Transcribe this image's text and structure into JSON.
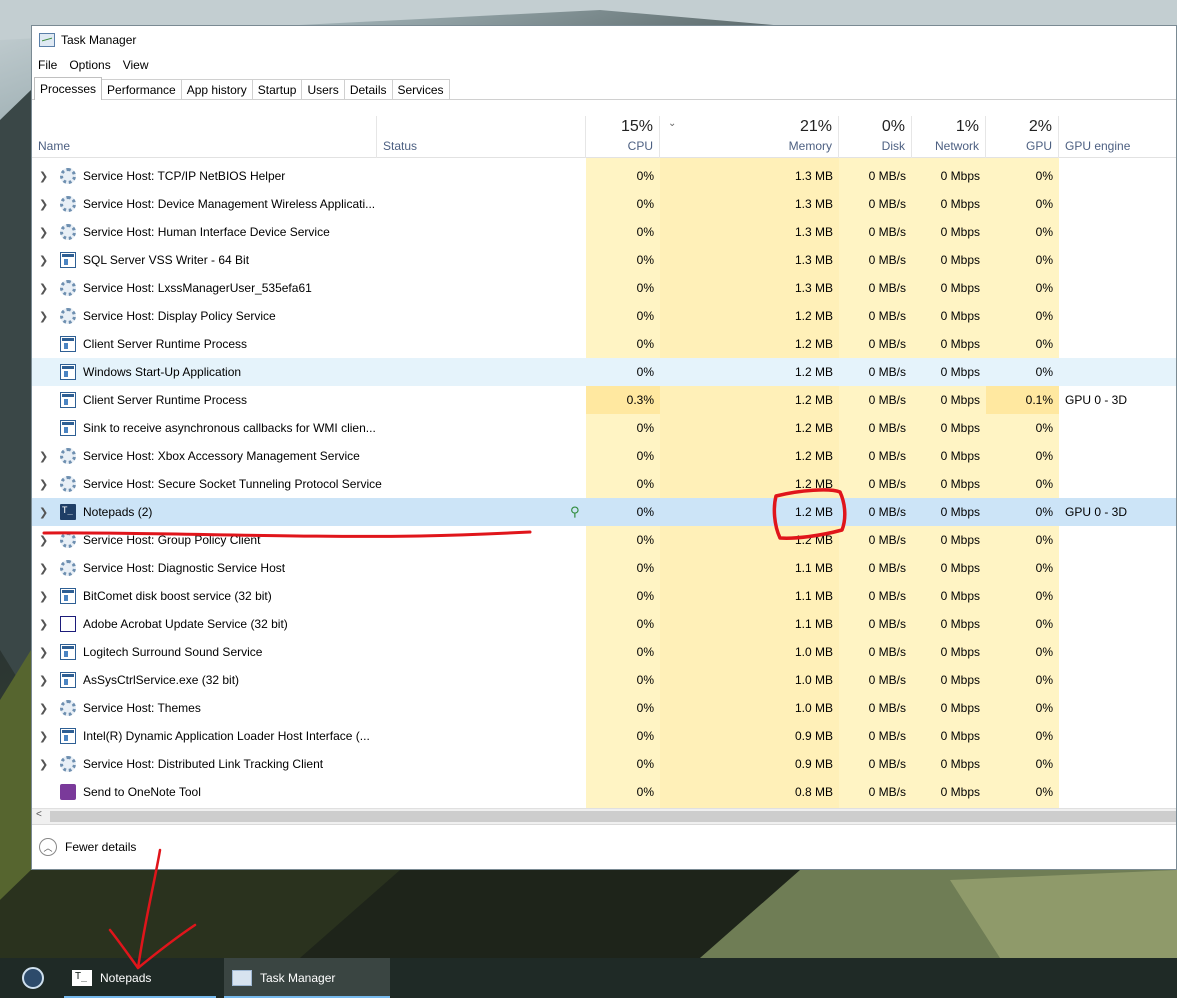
{
  "window": {
    "title": "Task Manager"
  },
  "menu": [
    "File",
    "Options",
    "View"
  ],
  "tabs": [
    "Processes",
    "Performance",
    "App history",
    "Startup",
    "Users",
    "Details",
    "Services"
  ],
  "columns": {
    "name": "Name",
    "status": "Status",
    "cpu": {
      "pct": "15%",
      "label": "CPU"
    },
    "memory": {
      "pct": "21%",
      "label": "Memory"
    },
    "disk": {
      "pct": "0%",
      "label": "Disk"
    },
    "network": {
      "pct": "1%",
      "label": "Network"
    },
    "gpu": {
      "pct": "2%",
      "label": "GPU"
    },
    "gpu_engine": "GPU engine"
  },
  "colors": {
    "cpu_heat": "#fff4c4",
    "mem_heat": "#fff0b8",
    "selected": "#cce4f7",
    "hover": "#e5f3fb",
    "annotation": "#e0151b"
  },
  "processes": [
    {
      "name": "Service Host: TCP/IP NetBIOS Helper",
      "icon": "gear-icon",
      "expand": true,
      "cpu": "0%",
      "memory": "1.3 MB",
      "disk": "0 MB/s",
      "network": "0 Mbps",
      "gpu": "0%",
      "engine": ""
    },
    {
      "name": "Service Host: Device Management Wireless Applicati...",
      "icon": "gear-icon",
      "expand": true,
      "cpu": "0%",
      "memory": "1.3 MB",
      "disk": "0 MB/s",
      "network": "0 Mbps",
      "gpu": "0%",
      "engine": ""
    },
    {
      "name": "Service Host: Human Interface Device Service",
      "icon": "gear-icon",
      "expand": true,
      "cpu": "0%",
      "memory": "1.3 MB",
      "disk": "0 MB/s",
      "network": "0 Mbps",
      "gpu": "0%",
      "engine": ""
    },
    {
      "name": "SQL Server VSS Writer - 64 Bit",
      "icon": "app-icon",
      "expand": true,
      "cpu": "0%",
      "memory": "1.3 MB",
      "disk": "0 MB/s",
      "network": "0 Mbps",
      "gpu": "0%",
      "engine": ""
    },
    {
      "name": "Service Host: LxssManagerUser_535efa61",
      "icon": "gear-icon",
      "expand": true,
      "cpu": "0%",
      "memory": "1.3 MB",
      "disk": "0 MB/s",
      "network": "0 Mbps",
      "gpu": "0%",
      "engine": ""
    },
    {
      "name": "Service Host: Display Policy Service",
      "icon": "gear-icon",
      "expand": true,
      "cpu": "0%",
      "memory": "1.2 MB",
      "disk": "0 MB/s",
      "network": "0 Mbps",
      "gpu": "0%",
      "engine": ""
    },
    {
      "name": "Client Server Runtime Process",
      "icon": "app-icon",
      "expand": false,
      "cpu": "0%",
      "memory": "1.2 MB",
      "disk": "0 MB/s",
      "network": "0 Mbps",
      "gpu": "0%",
      "engine": ""
    },
    {
      "name": "Windows Start-Up Application",
      "icon": "app-icon",
      "expand": false,
      "cpu": "0%",
      "memory": "1.2 MB",
      "disk": "0 MB/s",
      "network": "0 Mbps",
      "gpu": "0%",
      "engine": "",
      "state": "hover"
    },
    {
      "name": "Client Server Runtime Process",
      "icon": "app-icon",
      "expand": false,
      "cpu": "0.3%",
      "memory": "1.2 MB",
      "disk": "0 MB/s",
      "network": "0 Mbps",
      "gpu": "0.1%",
      "engine": "GPU 0 - 3D",
      "hot": true
    },
    {
      "name": "Sink to receive asynchronous callbacks for WMI clien...",
      "icon": "app-icon",
      "expand": false,
      "cpu": "0%",
      "memory": "1.2 MB",
      "disk": "0 MB/s",
      "network": "0 Mbps",
      "gpu": "0%",
      "engine": ""
    },
    {
      "name": "Service Host: Xbox Accessory Management Service",
      "icon": "gear-icon",
      "expand": true,
      "cpu": "0%",
      "memory": "1.2 MB",
      "disk": "0 MB/s",
      "network": "0 Mbps",
      "gpu": "0%",
      "engine": ""
    },
    {
      "name": "Service Host: Secure Socket Tunneling Protocol Service",
      "icon": "gear-icon",
      "expand": true,
      "cpu": "0%",
      "memory": "1.2 MB",
      "disk": "0 MB/s",
      "network": "0 Mbps",
      "gpu": "0%",
      "engine": ""
    },
    {
      "name": "Notepads (2)",
      "icon": "notepads-icon",
      "expand": true,
      "cpu": "0%",
      "memory": "1.2 MB",
      "disk": "0 MB/s",
      "network": "0 Mbps",
      "gpu": "0%",
      "engine": "GPU 0 - 3D",
      "state": "selected",
      "leaf": true
    },
    {
      "name": "Service Host: Group Policy Client",
      "icon": "gear-icon",
      "expand": true,
      "cpu": "0%",
      "memory": "1.2 MB",
      "disk": "0 MB/s",
      "network": "0 Mbps",
      "gpu": "0%",
      "engine": ""
    },
    {
      "name": "Service Host: Diagnostic Service Host",
      "icon": "gear-icon",
      "expand": true,
      "cpu": "0%",
      "memory": "1.1 MB",
      "disk": "0 MB/s",
      "network": "0 Mbps",
      "gpu": "0%",
      "engine": ""
    },
    {
      "name": "BitComet disk boost service (32 bit)",
      "icon": "app-icon",
      "expand": true,
      "cpu": "0%",
      "memory": "1.1 MB",
      "disk": "0 MB/s",
      "network": "0 Mbps",
      "gpu": "0%",
      "engine": ""
    },
    {
      "name": "Adobe Acrobat Update Service (32 bit)",
      "icon": "window-icon",
      "expand": true,
      "cpu": "0%",
      "memory": "1.1 MB",
      "disk": "0 MB/s",
      "network": "0 Mbps",
      "gpu": "0%",
      "engine": ""
    },
    {
      "name": "Logitech Surround Sound Service",
      "icon": "app-icon",
      "expand": true,
      "cpu": "0%",
      "memory": "1.0 MB",
      "disk": "0 MB/s",
      "network": "0 Mbps",
      "gpu": "0%",
      "engine": ""
    },
    {
      "name": "AsSysCtrlService.exe (32 bit)",
      "icon": "app-icon",
      "expand": true,
      "cpu": "0%",
      "memory": "1.0 MB",
      "disk": "0 MB/s",
      "network": "0 Mbps",
      "gpu": "0%",
      "engine": ""
    },
    {
      "name": "Service Host: Themes",
      "icon": "gear-icon",
      "expand": true,
      "cpu": "0%",
      "memory": "1.0 MB",
      "disk": "0 MB/s",
      "network": "0 Mbps",
      "gpu": "0%",
      "engine": ""
    },
    {
      "name": "Intel(R) Dynamic Application Loader Host Interface (...",
      "icon": "app-icon",
      "expand": true,
      "cpu": "0%",
      "memory": "0.9 MB",
      "disk": "0 MB/s",
      "network": "0 Mbps",
      "gpu": "0%",
      "engine": ""
    },
    {
      "name": "Service Host: Distributed Link Tracking Client",
      "icon": "gear-icon",
      "expand": true,
      "cpu": "0%",
      "memory": "0.9 MB",
      "disk": "0 MB/s",
      "network": "0 Mbps",
      "gpu": "0%",
      "engine": ""
    },
    {
      "name": "Send to OneNote Tool",
      "icon": "onenote-icon",
      "expand": false,
      "cpu": "0%",
      "memory": "0.8 MB",
      "disk": "0 MB/s",
      "network": "0 Mbps",
      "gpu": "0%",
      "engine": ""
    }
  ],
  "footer": {
    "fewer_details": "Fewer details"
  },
  "taskbar": [
    {
      "label": "",
      "icon": "steam-icon"
    },
    {
      "label": "Notepads",
      "icon": "notepads-icon",
      "running": true
    },
    {
      "label": "Task Manager",
      "icon": "task-manager-icon",
      "running": true,
      "active": true
    }
  ]
}
